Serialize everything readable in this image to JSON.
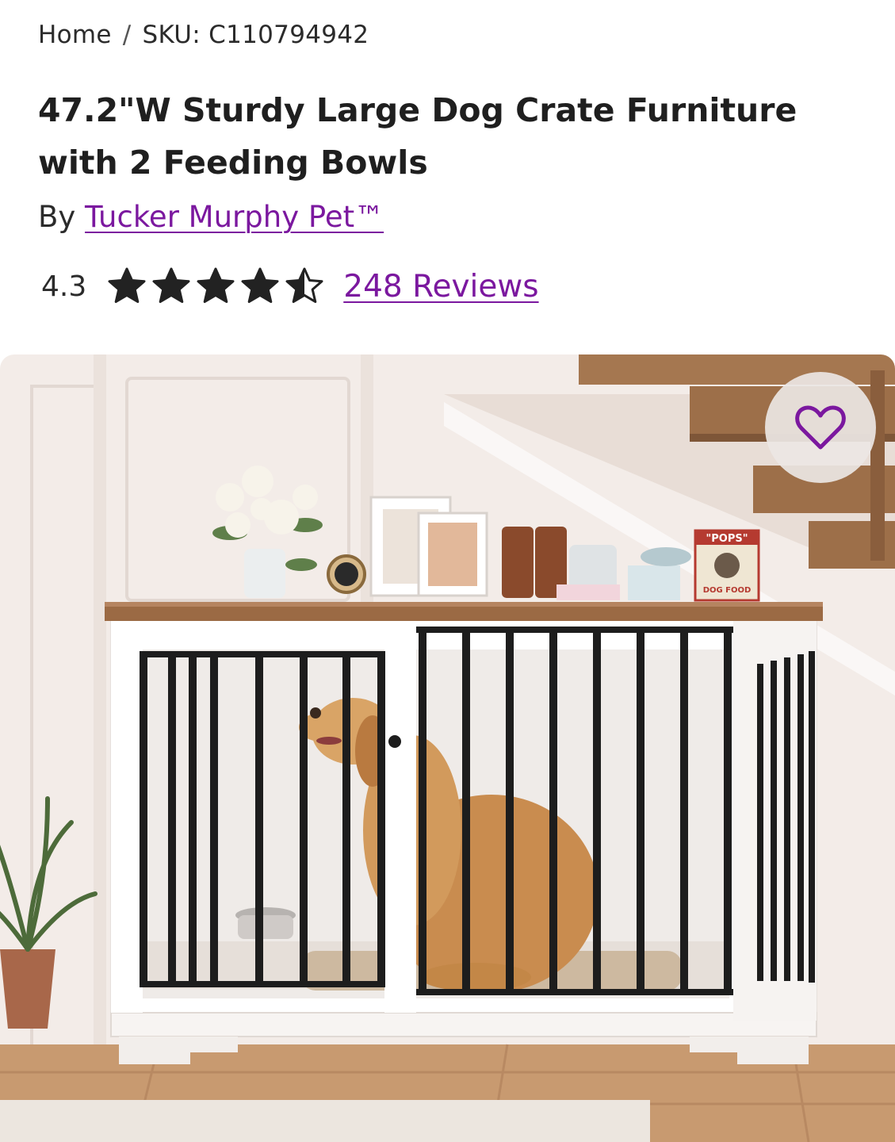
{
  "breadcrumb": {
    "home": "Home",
    "separator": "/",
    "sku": "SKU: C110794942"
  },
  "product": {
    "title": "47.2\"W Sturdy Large Dog Crate Furniture with 2 Feeding Bowls",
    "by_prefix": "By",
    "brand": "Tucker Murphy Pet™"
  },
  "rating": {
    "score": "4.3",
    "stars_value": 4.3,
    "stars_max": 5,
    "reviews_link": "248 Reviews"
  },
  "image": {
    "label_pops": "\"POPS\"",
    "label_dog_food": "DOG FOOD"
  },
  "icons": {
    "star": "star-icon",
    "favorite": "heart-outline-icon"
  },
  "colors": {
    "link": "#7b189f",
    "text": "#222222",
    "star": "#222222"
  }
}
